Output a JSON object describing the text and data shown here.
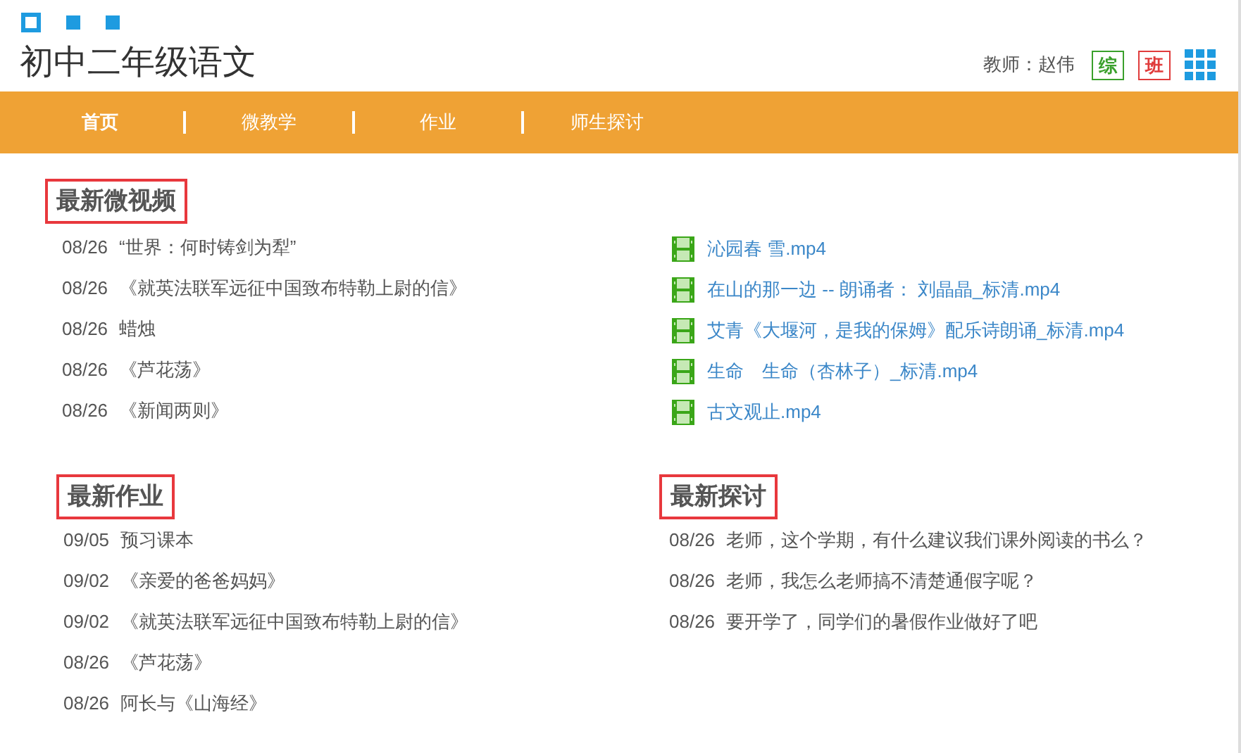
{
  "header": {
    "title": "初中二年级语文",
    "teacher": "教师：赵伟",
    "badges": [
      {
        "label": "综",
        "color": "#3aa02c"
      },
      {
        "label": "班",
        "color": "#e03c3c"
      }
    ]
  },
  "nav": [
    {
      "label": "首页",
      "selected": true
    },
    {
      "label": "微教学",
      "selected": false
    },
    {
      "label": "作业",
      "selected": false
    },
    {
      "label": "师生探讨",
      "selected": false
    }
  ],
  "videos": {
    "heading": "最新微视频",
    "items": [
      {
        "date": "08/26",
        "title": "“世界：何时铸剑为犁”"
      },
      {
        "date": "08/26",
        "title": "《就英法联军远征中国致布特勒上尉的信》"
      },
      {
        "date": "08/26",
        "title": "蜡烛"
      },
      {
        "date": "08/26",
        "title": "《芦花荡》"
      },
      {
        "date": "08/26",
        "title": "《新闻两则》"
      }
    ]
  },
  "files": [
    "沁园春 雪.mp4",
    "在山的那一边 -- 朗诵者： 刘晶晶_标清.mp4",
    "艾青《大堰河，是我的保姆》配乐诗朗诵_标清.mp4",
    "生命　生命（杏林子）_标清.mp4",
    "古文观止.mp4"
  ],
  "homework": {
    "heading": "最新作业",
    "items": [
      {
        "date": "09/05",
        "title": "预习课本"
      },
      {
        "date": "09/02",
        "title": "《亲爱的爸爸妈妈》"
      },
      {
        "date": "09/02",
        "title": "《就英法联军远征中国致布特勒上尉的信》"
      },
      {
        "date": "08/26",
        "title": "《芦花荡》"
      },
      {
        "date": "08/26",
        "title": "阿长与《山海经》"
      }
    ]
  },
  "discussions": {
    "heading": "最新探讨",
    "items": [
      {
        "date": "08/26",
        "title": "老师，这个学期，有什么建议我们课外阅读的书么？"
      },
      {
        "date": "08/26",
        "title": "老师，我怎么老师搞不清楚通假字呢？"
      },
      {
        "date": "08/26",
        "title": "要开学了，同学们的暑假作业做好了吧"
      }
    ]
  }
}
